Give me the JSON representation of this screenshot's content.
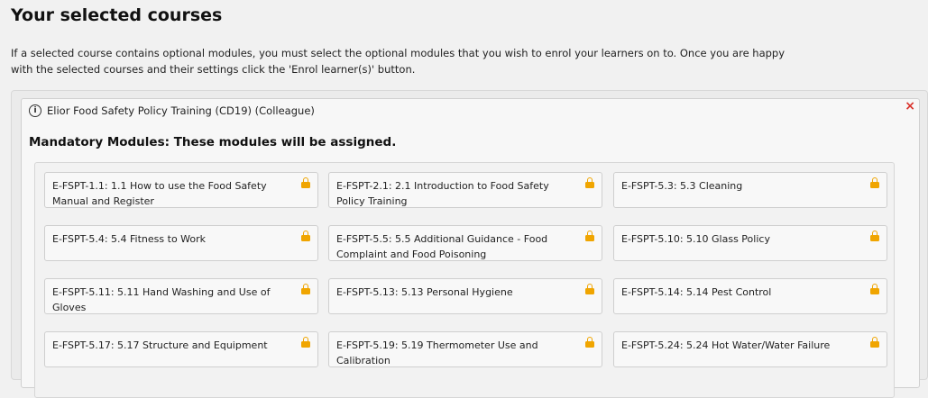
{
  "page": {
    "title": "Your selected courses",
    "intro_line1": "If a selected course contains optional modules, you must select the optional modules that you wish to enrol your learners on to. Once you are happy",
    "intro_line2": "with the selected courses and their settings click the 'Enrol learner(s)' button."
  },
  "course": {
    "info_icon": "info-icon",
    "name": "Elior Food Safety Policy Training (CD19) (Colleague)",
    "close_icon": "close-icon",
    "mandatory_heading": "Mandatory Modules: These modules will be assigned.",
    "lock_color": "#f0a500",
    "close_color": "#d9322b",
    "modules": [
      {
        "label": "E-FSPT-1.1: 1.1 How to use the Food Safety Manual and Register"
      },
      {
        "label": "E-FSPT-2.1: 2.1 Introduction to Food Safety Policy Training"
      },
      {
        "label": "E-FSPT-5.3: 5.3 Cleaning"
      },
      {
        "label": "E-FSPT-5.4: 5.4 Fitness to Work"
      },
      {
        "label": "E-FSPT-5.5: 5.5 Additional Guidance - Food Complaint and Food Poisoning"
      },
      {
        "label": "E-FSPT-5.10: 5.10 Glass Policy"
      },
      {
        "label": "E-FSPT-5.11: 5.11 Hand Washing and Use of Gloves"
      },
      {
        "label": "E-FSPT-5.13: 5.13 Personal Hygiene"
      },
      {
        "label": "E-FSPT-5.14: 5.14 Pest Control"
      },
      {
        "label": "E-FSPT-5.17: 5.17 Structure and Equipment"
      },
      {
        "label": "E-FSPT-5.19: 5.19 Thermometer Use and Calibration"
      },
      {
        "label": "E-FSPT-5.24: 5.24 Hot Water/Water Failure"
      }
    ]
  }
}
